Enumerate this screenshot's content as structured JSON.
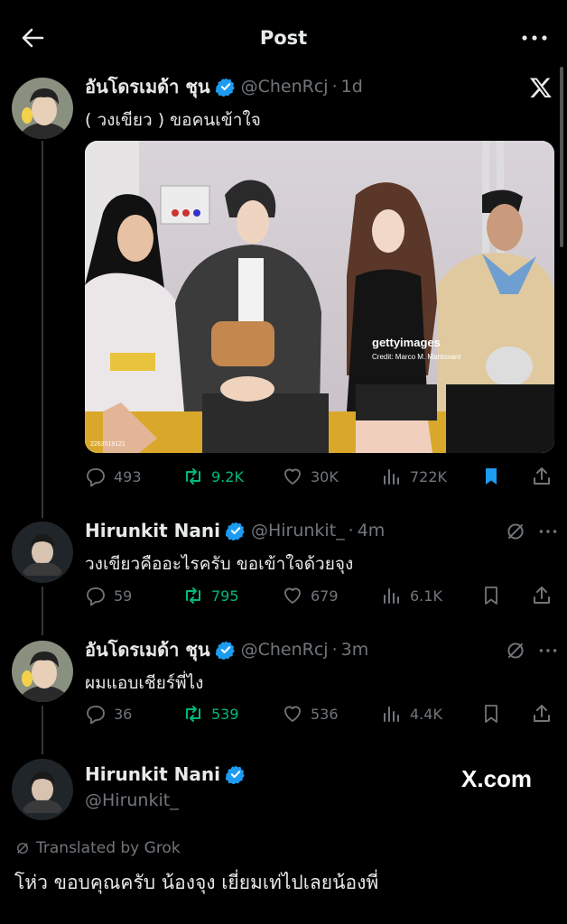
{
  "header": {
    "title": "Post"
  },
  "colors": {
    "background": "#000000",
    "text": "#e7e9ea",
    "muted": "#71767b",
    "green": "#00ba7c",
    "blue": "#1d9bf0",
    "verified": "#1d9bf0"
  },
  "main_post": {
    "name": "อันโดรเมด้า ชุน",
    "handle": "@ChenRcj",
    "time": "1d",
    "text": "( วงเขียว ) ขอคนเข้าใจ",
    "image": {
      "watermark_brand": "gettyimages",
      "credit": "Credit: Marco M. Mantovani",
      "image_id": "2263519121"
    },
    "stats": {
      "replies": "493",
      "reposts": "9.2K",
      "likes": "30K",
      "views": "722K"
    }
  },
  "replies": [
    {
      "name": "Hirunkit Nani",
      "handle": "@Hirunkit_",
      "time": "4m",
      "text": "วงเขียวคืออะไรครับ ขอเข้าใจด้วยจุง",
      "stats": {
        "replies": "59",
        "reposts": "795",
        "likes": "679",
        "views": "6.1K"
      }
    },
    {
      "name": "อันโดรเมด้า ชุน",
      "handle": "@ChenRcj",
      "time": "3m",
      "text": "ผมแอบเชียร์พี่ไง",
      "stats": {
        "replies": "36",
        "reposts": "539",
        "likes": "536",
        "views": "4.4K"
      }
    }
  ],
  "card": {
    "name": "Hirunkit Nani",
    "handle": "@Hirunkit_",
    "site": "X.com",
    "translated_label": "Translated by Grok",
    "translated_text": "โห่ว ขอบคุณครับ น้องจุง เยี่ยมเท่ไปเลยน้องพี่"
  },
  "icons": [
    "back-arrow-icon",
    "more-icon",
    "x-logo-icon",
    "verified-icon",
    "reply-icon",
    "repost-icon",
    "like-icon",
    "views-icon",
    "bookmark-icon",
    "share-icon",
    "grok-icon"
  ]
}
